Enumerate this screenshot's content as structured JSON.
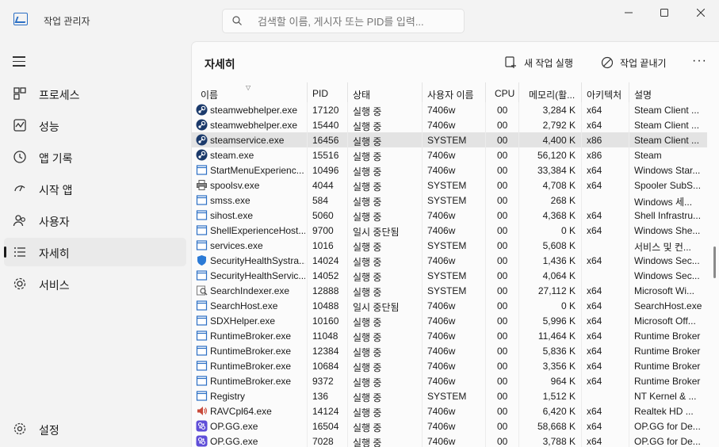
{
  "app": {
    "title": "작업 관리자",
    "search_placeholder": "검색할 이름, 게시자 또는 PID를 입력..."
  },
  "nav": {
    "items": [
      {
        "label": "프로세스",
        "icon": "processes-icon"
      },
      {
        "label": "성능",
        "icon": "performance-icon"
      },
      {
        "label": "앱 기록",
        "icon": "app-history-icon"
      },
      {
        "label": "시작 앱",
        "icon": "startup-apps-icon"
      },
      {
        "label": "사용자",
        "icon": "users-icon"
      },
      {
        "label": "자세히",
        "icon": "details-icon"
      },
      {
        "label": "서비스",
        "icon": "services-icon"
      }
    ],
    "settings_label": "설정"
  },
  "page": {
    "title": "자세히",
    "run_task_label": "새 작업 실행",
    "end_task_label": "작업 끝내기",
    "more_label": "···"
  },
  "table": {
    "columns": [
      "이름",
      "PID",
      "상태",
      "사용자 이름",
      "CPU",
      "메모리(활...",
      "아키텍처",
      "설명"
    ],
    "rows": [
      [
        "steamwebhelper.exe",
        "17120",
        "실행 중",
        "7406w",
        "00",
        "3,284 K",
        "x64",
        "Steam Client ..."
      ],
      [
        "steamwebhelper.exe",
        "15440",
        "실행 중",
        "7406w",
        "00",
        "2,792 K",
        "x64",
        "Steam Client ..."
      ],
      [
        "steamservice.exe",
        "16456",
        "실행 중",
        "SYSTEM",
        "00",
        "4,400 K",
        "x86",
        "Steam Client ..."
      ],
      [
        "steam.exe",
        "15516",
        "실행 중",
        "7406w",
        "00",
        "56,120 K",
        "x86",
        "Steam"
      ],
      [
        "StartMenuExperienc...",
        "10496",
        "실행 중",
        "7406w",
        "00",
        "33,384 K",
        "x64",
        "Windows Star..."
      ],
      [
        "spoolsv.exe",
        "4044",
        "실행 중",
        "SYSTEM",
        "00",
        "4,708 K",
        "x64",
        "Spooler SubS..."
      ],
      [
        "smss.exe",
        "584",
        "실행 중",
        "SYSTEM",
        "00",
        "268 K",
        "",
        "Windows 세..."
      ],
      [
        "sihost.exe",
        "5060",
        "실행 중",
        "7406w",
        "00",
        "4,368 K",
        "x64",
        "Shell Infrastru..."
      ],
      [
        "ShellExperienceHost...",
        "9700",
        "일시 중단됨",
        "7406w",
        "00",
        "0 K",
        "x64",
        "Windows She..."
      ],
      [
        "services.exe",
        "1016",
        "실행 중",
        "SYSTEM",
        "00",
        "5,608 K",
        "",
        "서비스 및 컨..."
      ],
      [
        "SecurityHealthSystra...",
        "14024",
        "실행 중",
        "7406w",
        "00",
        "1,436 K",
        "x64",
        "Windows Sec..."
      ],
      [
        "SecurityHealthServic...",
        "14052",
        "실행 중",
        "SYSTEM",
        "00",
        "4,064 K",
        "",
        "Windows Sec..."
      ],
      [
        "SearchIndexer.exe",
        "12888",
        "실행 중",
        "SYSTEM",
        "00",
        "27,112 K",
        "x64",
        "Microsoft Wi..."
      ],
      [
        "SearchHost.exe",
        "10488",
        "일시 중단됨",
        "7406w",
        "00",
        "0 K",
        "x64",
        "SearchHost.exe"
      ],
      [
        "SDXHelper.exe",
        "10160",
        "실행 중",
        "7406w",
        "00",
        "5,996 K",
        "x64",
        "Microsoft Off..."
      ],
      [
        "RuntimeBroker.exe",
        "11048",
        "실행 중",
        "7406w",
        "00",
        "11,464 K",
        "x64",
        "Runtime Broker"
      ],
      [
        "RuntimeBroker.exe",
        "12384",
        "실행 중",
        "7406w",
        "00",
        "5,836 K",
        "x64",
        "Runtime Broker"
      ],
      [
        "RuntimeBroker.exe",
        "10684",
        "실행 중",
        "7406w",
        "00",
        "3,356 K",
        "x64",
        "Runtime Broker"
      ],
      [
        "RuntimeBroker.exe",
        "9372",
        "실행 중",
        "7406w",
        "00",
        "964 K",
        "x64",
        "Runtime Broker"
      ],
      [
        "Registry",
        "136",
        "실행 중",
        "SYSTEM",
        "00",
        "1,512 K",
        "",
        "NT Kernel & ..."
      ],
      [
        "RAVCpl64.exe",
        "14124",
        "실행 중",
        "7406w",
        "00",
        "6,420 K",
        "x64",
        "Realtek HD ..."
      ],
      [
        "OP.GG.exe",
        "16504",
        "실행 중",
        "7406w",
        "00",
        "58,668 K",
        "x64",
        "OP.GG for De..."
      ],
      [
        "OP.GG.exe",
        "7028",
        "실행 중",
        "7406w",
        "00",
        "3,788 K",
        "x64",
        "OP.GG for De..."
      ]
    ],
    "row_icons": [
      "steam-icon",
      "steam-icon",
      "steam-icon",
      "steam-icon",
      "window-icon",
      "printer-icon",
      "window-icon",
      "window-icon",
      "window-icon",
      "window-icon",
      "shield-icon",
      "window-icon",
      "search-indexer-icon",
      "window-icon",
      "window-icon",
      "window-icon",
      "window-icon",
      "window-icon",
      "window-icon",
      "window-icon",
      "speaker-icon",
      "opgg-icon",
      "opgg-icon"
    ],
    "selected_row": 2
  },
  "colors": {
    "accent": "#2b6fc4",
    "selected_row": "#e3e3e3",
    "steam": "#1b3a6b",
    "opgg": "#5f4ed8"
  }
}
